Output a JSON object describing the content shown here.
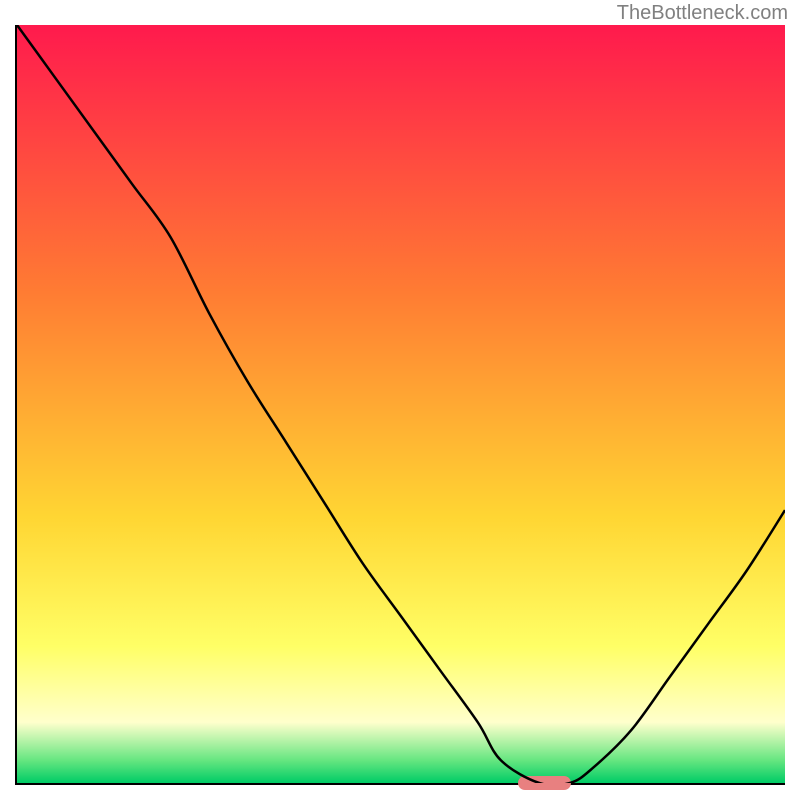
{
  "watermark_text": "TheBottleneck.com",
  "chart_data": {
    "type": "line",
    "title": "",
    "xlabel": "",
    "ylabel": "",
    "x": [
      0,
      5,
      10,
      15,
      20,
      25,
      30,
      35,
      40,
      45,
      50,
      55,
      60,
      63,
      68,
      72,
      75,
      80,
      85,
      90,
      95,
      100
    ],
    "y": [
      100,
      93,
      86,
      79,
      72,
      62,
      53,
      45,
      37,
      29,
      22,
      15,
      8,
      3,
      0,
      0,
      2,
      7,
      14,
      21,
      28,
      36
    ],
    "xlim": [
      0,
      100
    ],
    "ylim": [
      0,
      100
    ],
    "gradient_stops": [
      {
        "offset": 0,
        "color": "#ff1a4d"
      },
      {
        "offset": 35,
        "color": "#ff7b33"
      },
      {
        "offset": 65,
        "color": "#ffd633"
      },
      {
        "offset": 82,
        "color": "#ffff66"
      },
      {
        "offset": 92,
        "color": "#ffffcc"
      },
      {
        "offset": 97,
        "color": "#66e680"
      },
      {
        "offset": 100,
        "color": "#00cc66"
      }
    ],
    "marker": {
      "x_start": 65,
      "x_end": 72,
      "y": 0,
      "color": "#e88080"
    }
  }
}
